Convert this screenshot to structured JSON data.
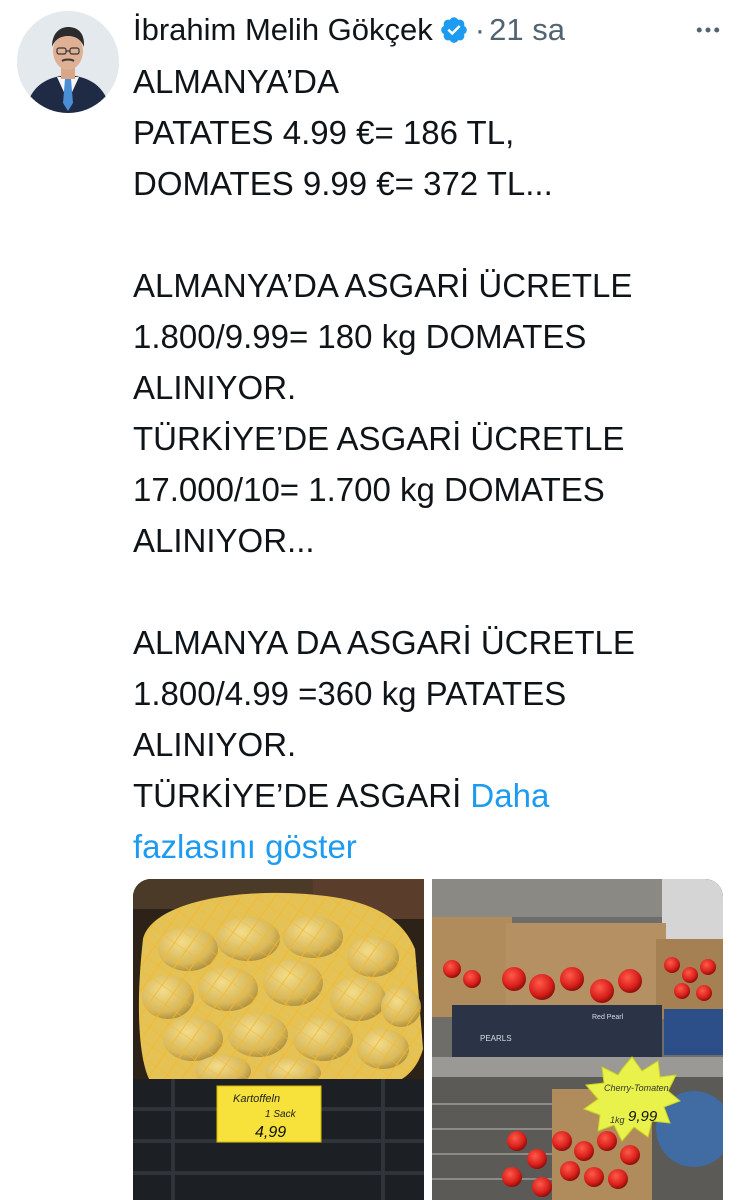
{
  "tweet": {
    "author_name": "İbrahim Melih Gökçek",
    "separator": "·",
    "timestamp": "21 sa",
    "lines": [
      "ALMANYA’DA",
      "PATATES 4.99 €= 186 TL,",
      "DOMATES 9.99 €= 372 TL...",
      "",
      "ALMANYA’DA ASGARİ ÜCRETLE",
      "1.800/9.99= 180 kg DOMATES",
      "ALINIYOR.",
      "TÜRKİYE’DE ASGARİ ÜCRETLE",
      "17.000/10= 1.700 kg DOMATES",
      "ALINIYOR...",
      "",
      "ALMANYA DA ASGARİ ÜCRETLE",
      "1.800/4.99 =360 kg PATATES",
      "ALINIYOR."
    ],
    "last_line_text": "TÜRKİYE’DE ASGARİ",
    "show_more_part1": "Daha",
    "show_more_part2": "fazlasını göster"
  },
  "photos": {
    "left": {
      "sign_title": "Kartoffeln",
      "sign_sub": "1 Sack",
      "sign_price": "4,99"
    },
    "right": {
      "sign_title": "Cherry-Tomaten",
      "sign_weight": "1kg",
      "sign_price": "9,99",
      "box_brand": "PEARLS",
      "box_label": "Red Pearl"
    }
  },
  "icons": {
    "verified": "verified-badge-icon",
    "more": "more-options-icon"
  },
  "colors": {
    "text": "#0f1419",
    "secondary": "#536471",
    "link": "#1d9bf0",
    "verified": "#1d9bf0"
  }
}
